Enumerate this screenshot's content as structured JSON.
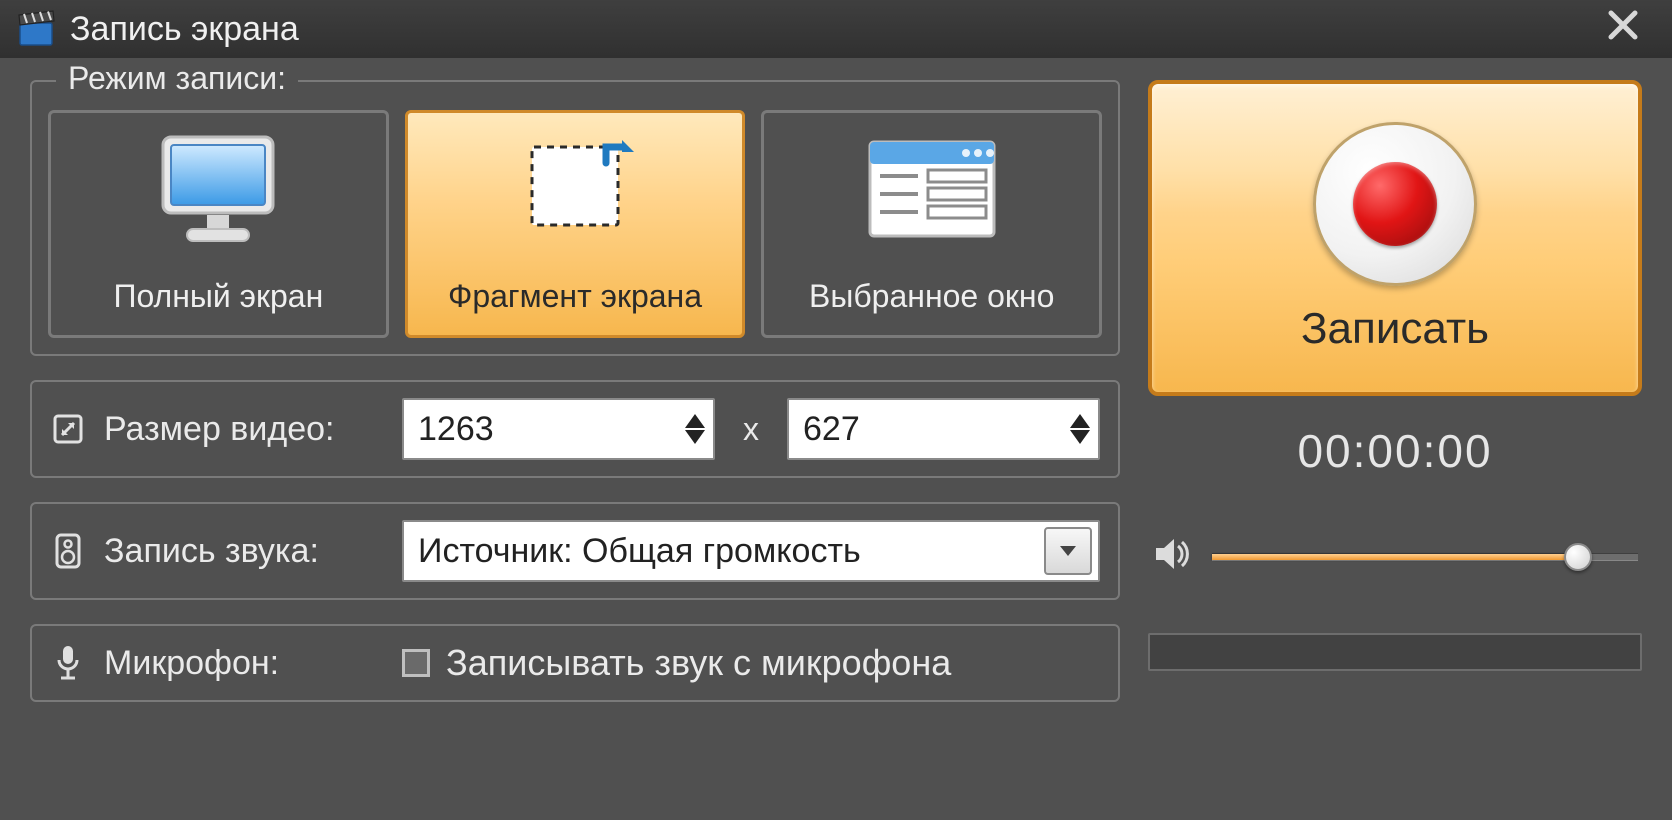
{
  "window": {
    "title": "Запись экрана"
  },
  "modes": {
    "legend": "Режим записи:",
    "fullscreen": "Полный экран",
    "region": "Фрагмент экрана",
    "window": "Выбранное окно"
  },
  "video_size": {
    "label": "Размер видео:",
    "width": "1263",
    "height": "627",
    "separator": "x"
  },
  "audio": {
    "label": "Запись звука:",
    "source_selected": "Источник: Общая громкость"
  },
  "mic": {
    "label": "Микрофон:",
    "checkbox_label": "Записывать звук с микрофона"
  },
  "record": {
    "button_label": "Записать",
    "timer": "00:00:00"
  }
}
